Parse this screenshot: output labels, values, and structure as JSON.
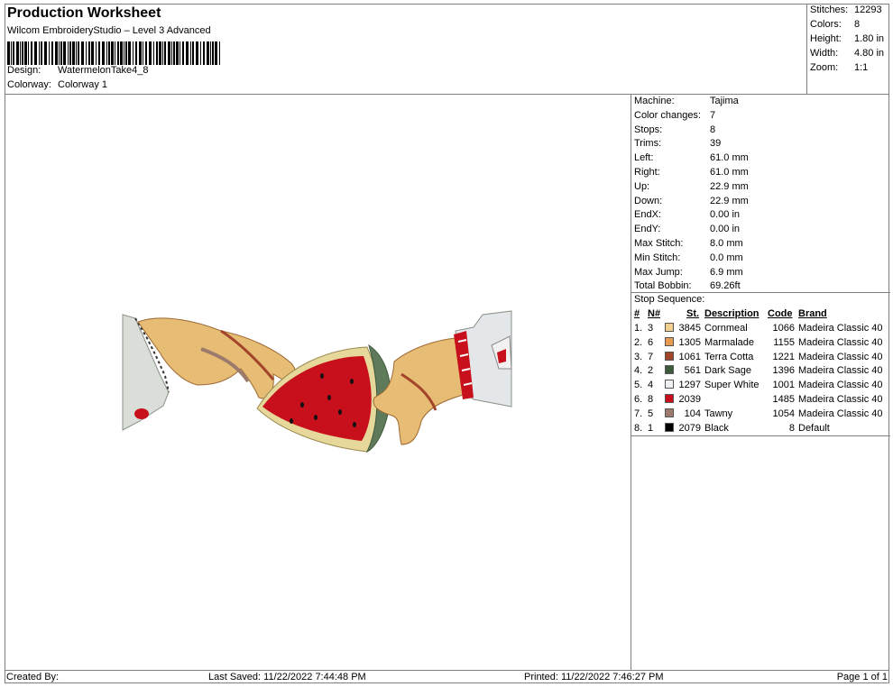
{
  "header": {
    "title": "Production Worksheet",
    "software": "Wilcom EmbroideryStudio – Level 3 Advanced",
    "design_label": "Design:",
    "design_value": "WatermelonTake4_8",
    "colorway_label": "Colorway:",
    "colorway_value": "Colorway 1"
  },
  "stats": [
    {
      "label": "Stitches:",
      "value": "12293"
    },
    {
      "label": "Colors:",
      "value": "8"
    },
    {
      "label": "Height:",
      "value": "1.80 in"
    },
    {
      "label": "Width:",
      "value": "4.80 in"
    },
    {
      "label": "Zoom:",
      "value": "1:1"
    }
  ],
  "machine_info": [
    {
      "label": "Machine:",
      "value": "Tajima"
    },
    {
      "label": "Color changes:",
      "value": "7"
    },
    {
      "label": "Stops:",
      "value": "8"
    },
    {
      "label": "Trims:",
      "value": "39"
    },
    {
      "label": "Left:",
      "value": "61.0 mm"
    },
    {
      "label": "Right:",
      "value": "61.0 mm"
    },
    {
      "label": "Up:",
      "value": "22.9 mm"
    },
    {
      "label": "Down:",
      "value": "22.9 mm"
    },
    {
      "label": "EndX:",
      "value": "0.00 in"
    },
    {
      "label": "EndY:",
      "value": "0.00 in"
    },
    {
      "label": "Max Stitch:",
      "value": "8.0 mm"
    },
    {
      "label": "Min Stitch:",
      "value": "0.0 mm"
    },
    {
      "label": "Max Jump:",
      "value": "6.9 mm"
    },
    {
      "label": "Total Bobbin:",
      "value": "69.26ft"
    }
  ],
  "stop_sequence": {
    "title": "Stop Sequence:",
    "headers": {
      "num": "#",
      "n": "N#",
      "st": "St.",
      "desc": "Description",
      "code": "Code",
      "brand": "Brand"
    },
    "rows": [
      {
        "idx": "1.",
        "n": "3",
        "color": "#f5cf8e",
        "st": "3845",
        "desc": "Cornmeal",
        "code": "1066",
        "brand": "Madeira Classic 40"
      },
      {
        "idx": "2.",
        "n": "6",
        "color": "#e89a4f",
        "st": "1305",
        "desc": "Marmalade",
        "code": "1155",
        "brand": "Madeira Classic 40"
      },
      {
        "idx": "3.",
        "n": "7",
        "color": "#a3452a",
        "st": "1061",
        "desc": "Terra Cotta",
        "code": "1221",
        "brand": "Madeira Classic 40"
      },
      {
        "idx": "4.",
        "n": "2",
        "color": "#3f5a3c",
        "st": "561",
        "desc": "Dark Sage",
        "code": "1396",
        "brand": "Madeira Classic 40"
      },
      {
        "idx": "5.",
        "n": "4",
        "color": "#eef2f6",
        "st": "1297",
        "desc": "Super White",
        "code": "1001",
        "brand": "Madeira Classic 40"
      },
      {
        "idx": "6.",
        "n": "8",
        "color": "#c8101c",
        "st": "2039",
        "desc": "",
        "code": "1485",
        "brand": "Madeira Classic 40"
      },
      {
        "idx": "7.",
        "n": "5",
        "color": "#9c7b6c",
        "st": "104",
        "desc": "Tawny",
        "code": "1054",
        "brand": "Madeira Classic 40"
      },
      {
        "idx": "8.",
        "n": "1",
        "color": "#000000",
        "st": "2079",
        "desc": "Black",
        "code": "8",
        "brand": "Default"
      }
    ]
  },
  "footer": {
    "created_by": "Created By:",
    "last_saved": "Last Saved: 11/22/2022 7:44:48 PM",
    "printed": "Printed: 11/22/2022 7:46:27 PM",
    "page": "Page 1 of 1"
  }
}
